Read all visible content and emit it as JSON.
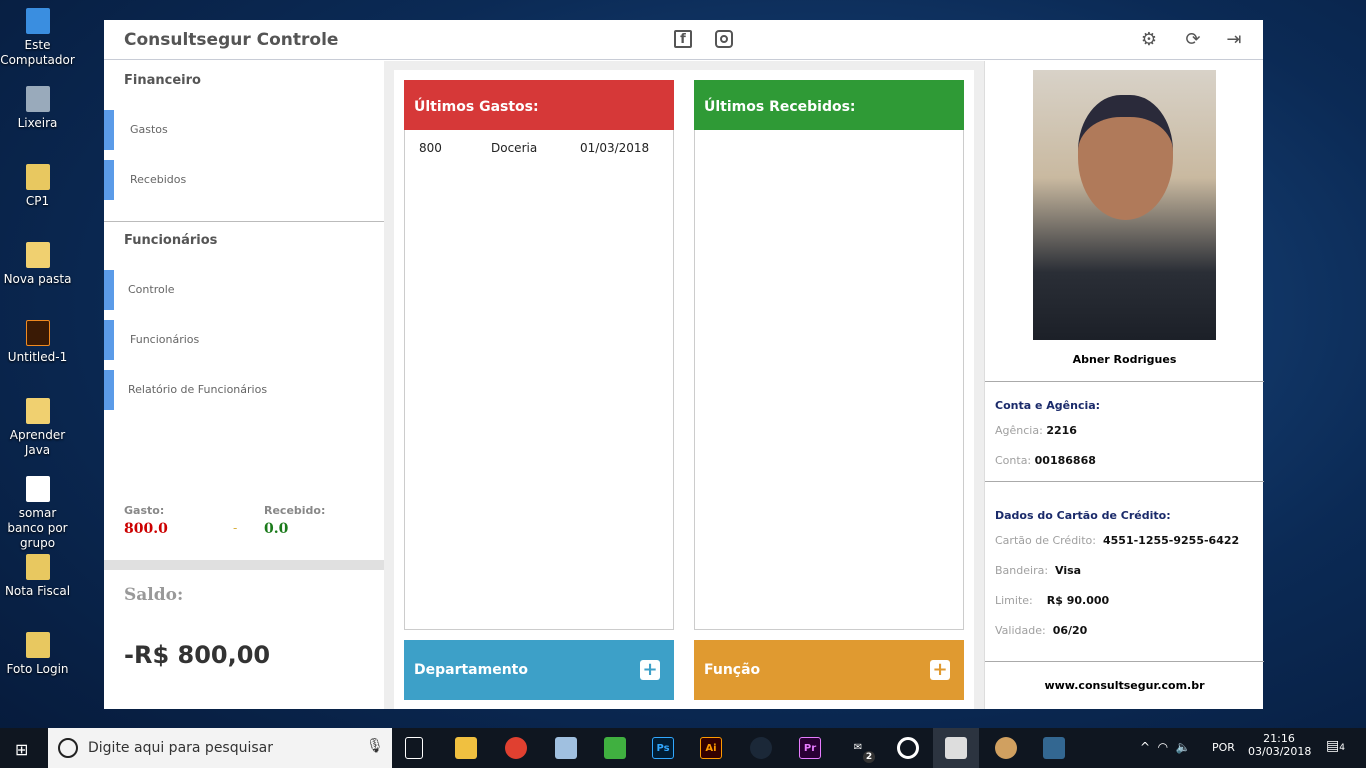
{
  "desktop": {
    "icons": [
      "Este Computador",
      "Lixeira",
      "CP1",
      "Nova pasta",
      "Untitled-1",
      "Aprender Java",
      "somar banco por grupo",
      "Nota Fiscal",
      "Foto Login"
    ]
  },
  "app": {
    "title": "Consultsegur Controle"
  },
  "sidebar": {
    "financeiro": "Financeiro",
    "items_fin": [
      "Gastos",
      "Recebidos"
    ],
    "funcionarios": "Funcionários",
    "items_func": [
      "Controle",
      "Funcionários",
      "Relatório de Funcionários"
    ],
    "gasto_label": "Gasto:",
    "gasto_value": "800.0",
    "separator": "-",
    "recebido_label": "Recebido:",
    "recebido_value": "0.0",
    "saldo_label": "Saldo:",
    "saldo_value": "-R$ 800,00"
  },
  "gastos": {
    "title": "Últimos Gastos:",
    "rows": [
      {
        "valor": "800",
        "desc": "Doceria",
        "data": "01/03/2018"
      }
    ]
  },
  "recebidos": {
    "title": "Últimos Recebidos:"
  },
  "buttons": {
    "departamento": "Departamento",
    "funcao": "Função"
  },
  "profile": {
    "name": "Abner Rodrigues",
    "conta_title": "Conta e Agência:",
    "agencia_label": "Agência:",
    "agencia": "2216",
    "conta_label": "Conta:",
    "conta": "00186868",
    "cartao_title": "Dados do Cartão de Crédito:",
    "cartao_label": "Cartão de Crédito:",
    "cartao": "4551-1255-9255-6422",
    "bandeira_label": "Bandeira:",
    "bandeira": "Visa",
    "limite_label": "Limite:",
    "limite": "R$ 90.000",
    "validade_label": "Validade:",
    "validade": "06/20",
    "site": "www.consultsegur.com.br"
  },
  "taskbar": {
    "search_placeholder": "Digite aqui para pesquisar",
    "apps": [
      "Ps",
      "Ai",
      "Pr"
    ],
    "mail_badge": "2",
    "lang": "POR",
    "time": "21:16",
    "date": "03/03/2018",
    "notif": "4"
  },
  "colors": {
    "red": "#d63838",
    "green": "#2f9a36",
    "blue": "#3da0c8",
    "orange": "#e09a30"
  }
}
